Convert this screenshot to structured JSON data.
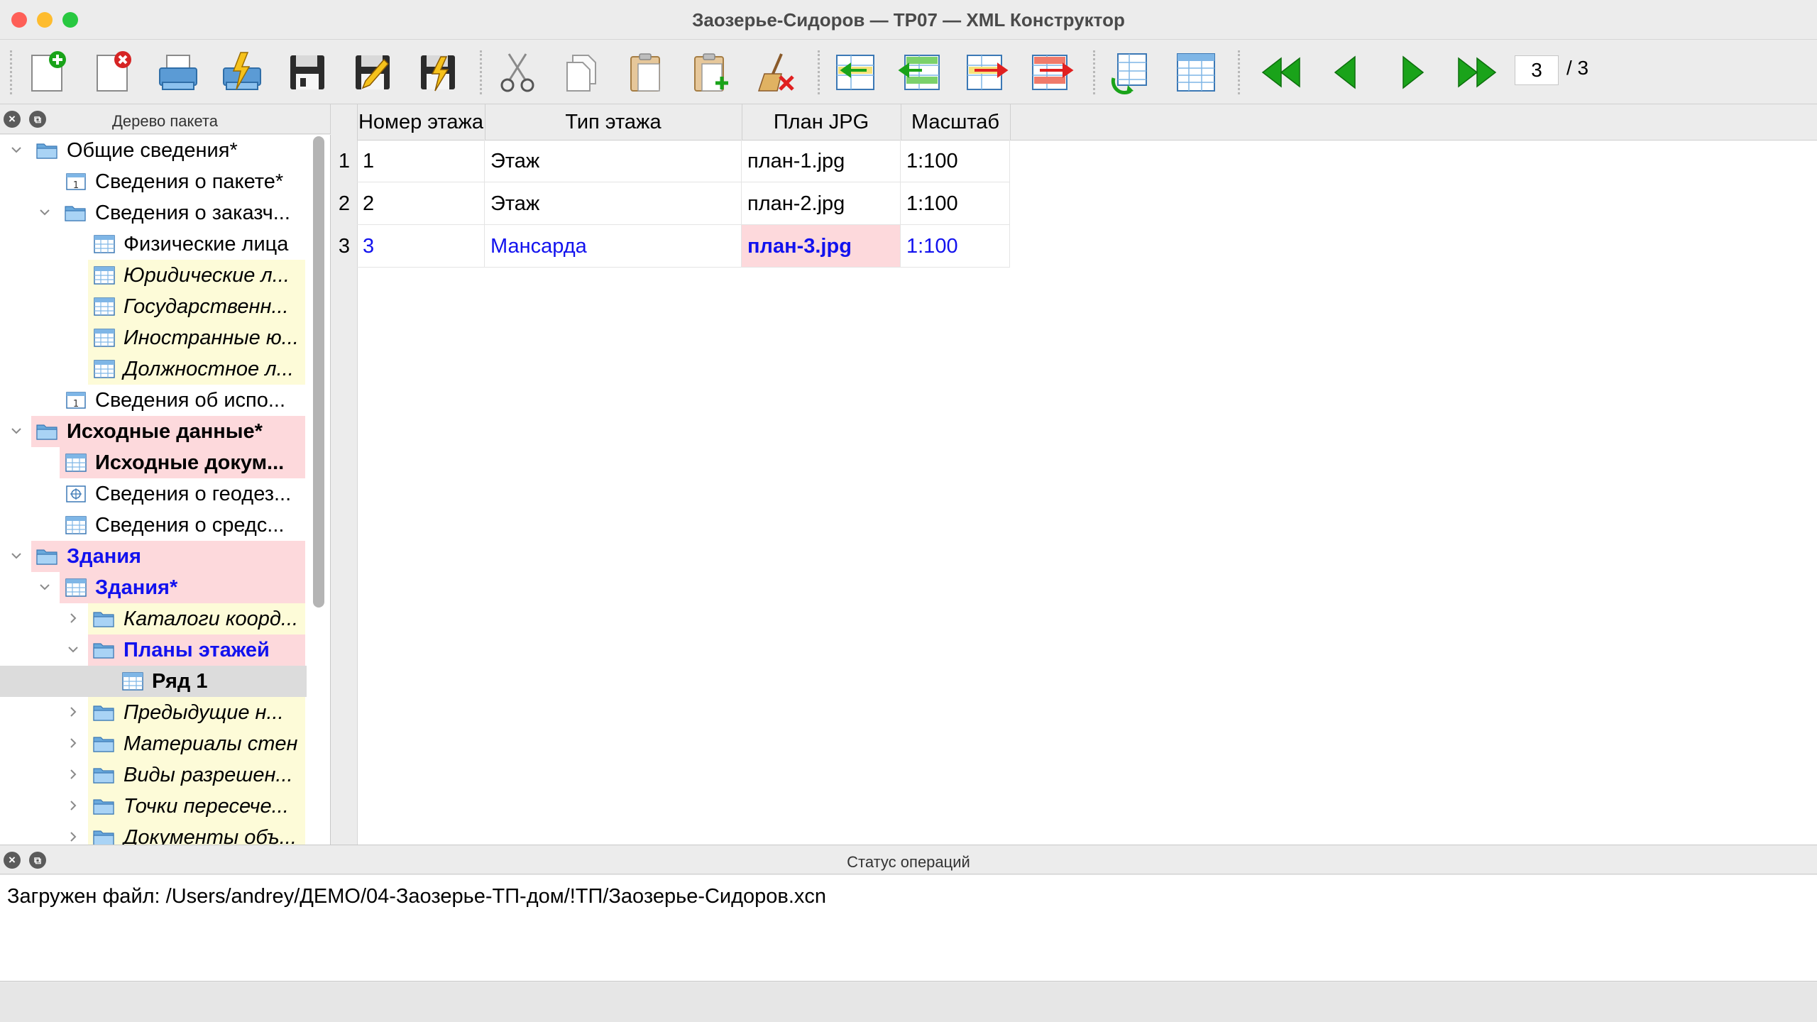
{
  "window": {
    "title": "Заозерье-Сидоров — ТР07 — XML Конструктор"
  },
  "toolbar": {
    "page_current": "3",
    "page_total": "/ 3"
  },
  "tree_panel": {
    "title": "Дерево пакета",
    "nodes": [
      {
        "label": "Общие сведения*"
      },
      {
        "label": "Сведения о пакете*"
      },
      {
        "label": "Сведения о заказч..."
      },
      {
        "label": "Физические лица"
      },
      {
        "label": "Юридические л..."
      },
      {
        "label": "Государственн..."
      },
      {
        "label": "Иностранные ю..."
      },
      {
        "label": "Должностное л..."
      },
      {
        "label": "Сведения об испо..."
      },
      {
        "label": "Исходные данные*"
      },
      {
        "label": "Исходные докум..."
      },
      {
        "label": "Сведения о геодез..."
      },
      {
        "label": "Сведения о средс..."
      },
      {
        "label": "Здания"
      },
      {
        "label": "Здания*"
      },
      {
        "label": "Каталоги коорд..."
      },
      {
        "label": "Планы этажей"
      },
      {
        "label": "Ряд 1"
      },
      {
        "label": "Предыдущие н..."
      },
      {
        "label": "Материалы стен"
      },
      {
        "label": "Виды разрешен..."
      },
      {
        "label": "Точки пересече..."
      },
      {
        "label": "Документы объ..."
      }
    ]
  },
  "grid": {
    "columns": [
      "Номер этажа",
      "Тип этажа",
      "План JPG",
      "Масштаб"
    ],
    "rows": [
      {
        "no": "1",
        "cells": [
          "1",
          "Этаж",
          "план-1.jpg",
          "1:100"
        ]
      },
      {
        "no": "2",
        "cells": [
          "2",
          "Этаж",
          "план-2.jpg",
          "1:100"
        ]
      },
      {
        "no": "3",
        "cells": [
          "3",
          "Мансарда",
          "план-3.jpg",
          "1:100"
        ]
      }
    ]
  },
  "status_panel": {
    "title": "Статус операций",
    "message": "Загружен файл: /Users/andrey/ДЕМО/04-Заозерье-ТП-дом/!ТП/Заозерье-Сидоров.xcn"
  },
  "colors": {
    "highlight_yellow": "#fdfbd8",
    "highlight_pink": "#fdd9dc",
    "link_blue": "#1212ee",
    "nav_green": "#1aa31a"
  }
}
